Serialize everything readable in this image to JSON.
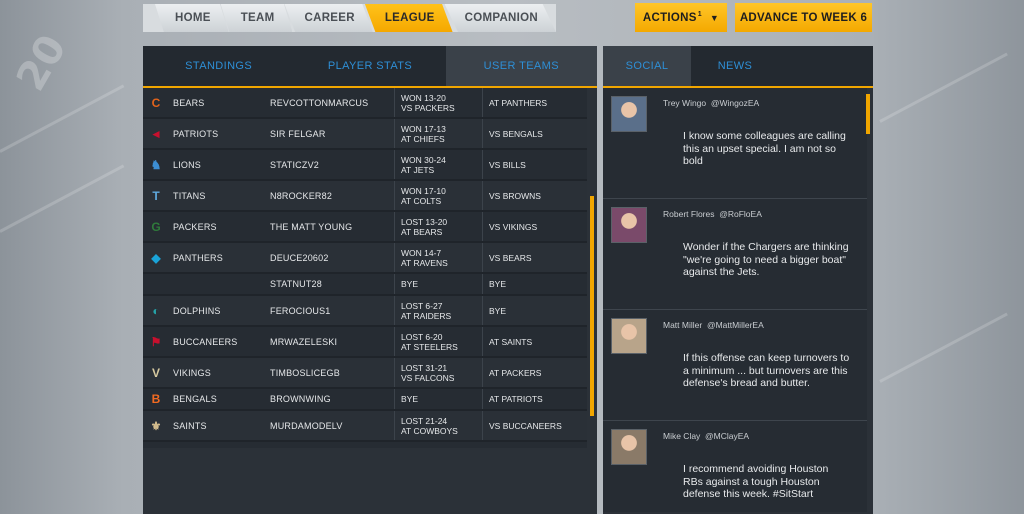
{
  "nav": {
    "tabs": [
      {
        "label": "HOME"
      },
      {
        "label": "TEAM"
      },
      {
        "label": "CAREER"
      },
      {
        "label": "LEAGUE"
      },
      {
        "label": "COMPANION"
      }
    ],
    "active_tab": "LEAGUE",
    "actions_label": "ACTIONS",
    "actions_badge": "1",
    "advance_label": "ADVANCE TO WEEK 6"
  },
  "league": {
    "tabs": [
      {
        "label": "STANDINGS"
      },
      {
        "label": "PLAYER STATS"
      },
      {
        "label": "USER TEAMS"
      }
    ],
    "active_tab": "USER TEAMS",
    "rows": [
      {
        "team": "BEARS",
        "user": "REVCOTTONMARCUS",
        "last1": "WON 13-20",
        "last2": "VS PACKERS",
        "next": "AT PANTHERS",
        "logo": "C",
        "logo_color": "#e2631b"
      },
      {
        "team": "PATRIOTS",
        "user": "SIR FELGAR",
        "last1": "WON 17-13",
        "last2": "AT CHIEFS",
        "next": "VS BENGALS",
        "logo": "◄",
        "logo_color": "#c8102e"
      },
      {
        "team": "LIONS",
        "user": "STATICZV2",
        "last1": "WON 30-24",
        "last2": "AT JETS",
        "next": "VS BILLS",
        "logo": "♞",
        "logo_color": "#3c8ed3"
      },
      {
        "team": "TITANS",
        "user": "N8ROCKER82",
        "last1": "WON 17-10",
        "last2": "AT COLTS",
        "next": "VS BROWNS",
        "logo": "T",
        "logo_color": "#5fa8dd"
      },
      {
        "team": "PACKERS",
        "user": "THE MATT YOUNG",
        "last1": "LOST 13-20",
        "last2": "AT BEARS",
        "next": "VS VIKINGS",
        "logo": "G",
        "logo_color": "#2f7a3b"
      },
      {
        "team": "PANTHERS",
        "user": "DEUCE20602",
        "last1": "WON 14-7",
        "last2": "AT RAVENS",
        "next": "VS BEARS",
        "logo": "◆",
        "logo_color": "#1aa3d8"
      },
      {
        "team": "",
        "user": "STATNUT28",
        "last1": "BYE",
        "last2": "",
        "next": "BYE",
        "logo": "",
        "logo_color": "#000000"
      },
      {
        "team": "DOLPHINS",
        "user": "FEROCIOUS1",
        "last1": "LOST 6-27",
        "last2": "AT RAIDERS",
        "next": "BYE",
        "logo": "◐",
        "logo_color": "#25a3a8"
      },
      {
        "team": "BUCCANEERS",
        "user": "MRWAZELESKI",
        "last1": "LOST 6-20",
        "last2": "AT STEELERS",
        "next": "AT SAINTS",
        "logo": "⚑",
        "logo_color": "#c8102e"
      },
      {
        "team": "VIKINGS",
        "user": "TIMBOSLICEGB",
        "last1": "LOST 31-21",
        "last2": "VS FALCONS",
        "next": "AT PACKERS",
        "logo": "V",
        "logo_color": "#d6c9a0"
      },
      {
        "team": "BENGALS",
        "user": "BROWNWING",
        "last1": "BYE",
        "last2": "",
        "next": "AT PATRIOTS",
        "logo": "B",
        "logo_color": "#f26a21"
      },
      {
        "team": "SAINTS",
        "user": "MURDAMODELV",
        "last1": "LOST 21-24",
        "last2": "AT COWBOYS",
        "next": "VS BUCCANEERS",
        "logo": "⚜",
        "logo_color": "#d3bc8d"
      }
    ]
  },
  "social": {
    "tabs": [
      {
        "label": "SOCIAL"
      },
      {
        "label": "NEWS"
      }
    ],
    "active_tab": "SOCIAL",
    "posts": [
      {
        "author": "Trey Wingo",
        "handle": "@WingozEA",
        "text": "I know some colleagues are calling this an upset special. I am not so bold",
        "avatar_color": "#5a6f8a"
      },
      {
        "author": "Robert Flores",
        "handle": "@RoFloEA",
        "text": "Wonder if the Chargers are thinking \"we're going to need a bigger boat\" against the Jets.",
        "avatar_color": "#7a4a6a"
      },
      {
        "author": "Matt Miller",
        "handle": "@MattMillerEA",
        "text": "If this offense can keep turnovers to a minimum ... but turnovers are this defense's bread and butter.",
        "avatar_color": "#b8a48a"
      },
      {
        "author": "Mike Clay",
        "handle": "@MClayEA",
        "text": "I recommend avoiding Houston RBs against a tough Houston defense this week. #SitStart",
        "avatar_color": "#8a7a68"
      }
    ]
  }
}
